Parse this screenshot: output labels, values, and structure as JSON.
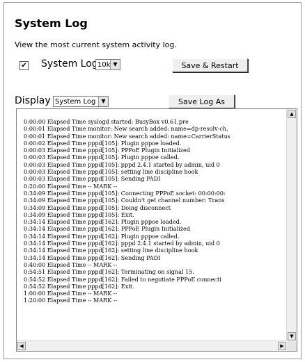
{
  "page": {
    "title": "System Log",
    "description": "View the most current system activity log."
  },
  "log_settings": {
    "checkbox_checked": true,
    "checkbox_mark": "✔",
    "label": "System Log",
    "size_value": "10k",
    "save_restart_label": "Save & Restart"
  },
  "display": {
    "label": "Display",
    "select_value": "System Log",
    "save_log_label": "Save Log As"
  },
  "log_lines": [
    "0:00:00 Elapsed Time syslogd started: BusyBox v0.61.pre",
    "0:00:01 Elapsed Time monitor: New search added: name=dp-resolv-ch,",
    "0:00:01 Elapsed Time monitor: New search added: name=CarrierStatus",
    "0:00:02 Elapsed Time pppd[105]: Plugin pppoe loaded.",
    "0:00:03 Elapsed Time pppd[105]: PPPoE Plugin Initialized",
    "0:00:03 Elapsed Time pppd[105]: Plugin pppoe called.",
    "0:00:03 Elapsed Time pppd[105]: pppd 2.4.1 started by admin, uid 0",
    "0:00:03 Elapsed Time pppd[105]: setting line discipline hook",
    "0:00:03 Elapsed Time pppd[105]: Sending PADI",
    "0:20:00 Elapsed Time -- MARK --",
    "0:34:09 Elapsed Time pppd[105]: Connecting PPPoE socket: 00:00:00:",
    "0:34:09 Elapsed Time pppd[105]: Couldn't get channel number: Trans",
    "0:34:09 Elapsed Time pppd[105]: Doing disconnect",
    "0:34:09 Elapsed Time pppd[105]: Exit.",
    "0:34:14 Elapsed Time pppd[162]: Plugin pppoe loaded.",
    "0:34:14 Elapsed Time pppd[162]: PPPoE Plugin Initialized",
    "0:34:14 Elapsed Time pppd[162]: Plugin pppoe called.",
    "0:34:14 Elapsed Time pppd[162]: pppd 2.4.1 started by admin, uid 0",
    "0:34:14 Elapsed Time pppd[162]: setting line discipline hook",
    "0:34:14 Elapsed Time pppd[162]: Sending PADI",
    "0:40:00 Elapsed Time -- MARK --",
    "0:54:51 Elapsed Time pppd[162]: Terminating on signal 15.",
    "0:54:52 Elapsed Time pppd[162]: Failed to negotiate PPPoE connecti",
    "0:54:52 Elapsed Time pppd[162]: Exit.",
    "1:00:00 Elapsed Time -- MARK --",
    "1:20:00 Elapsed Time -- MARK --"
  ],
  "icons": {
    "dropdown": "▼",
    "scroll_up": "▲",
    "scroll_down": "▼",
    "scroll_left": "◀",
    "scroll_right": "▶"
  }
}
